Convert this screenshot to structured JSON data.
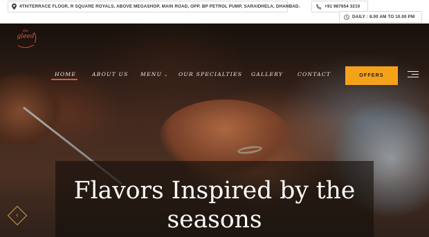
{
  "topbar": {
    "address": "4TH/TERRACE FLOOR, R SQUARE ROYALS, ABOVE MEGASHOP, MAIN ROAD, OPP. BP PETROL PUMP, SARAIDHELA, DHANBAD.",
    "phone": "+91 987654 3210",
    "hours": "DAILY : 8.00 AM TO 10.00 PM",
    "icons": {
      "address": "map-pin-icon",
      "phone": "phone-icon",
      "hours": "clock-icon"
    }
  },
  "logo": {
    "top": "the",
    "name": "gleed"
  },
  "nav": {
    "items": [
      {
        "label": "HOME",
        "active": true
      },
      {
        "label": "ABOUT US"
      },
      {
        "label": "MENU",
        "has_dropdown": true
      },
      {
        "label": "OUR SPECIALTIES"
      },
      {
        "label": "GALLERY"
      },
      {
        "label": "CONTACT"
      }
    ],
    "offers_label": "OFFERS",
    "accent_color": "#e4573d",
    "button_color": "#f5a21b"
  },
  "hero": {
    "caption": "Flavors Inspired by the seasons",
    "prev_icon": "chevron-left-icon",
    "arrow_color": "#d2a44a"
  }
}
